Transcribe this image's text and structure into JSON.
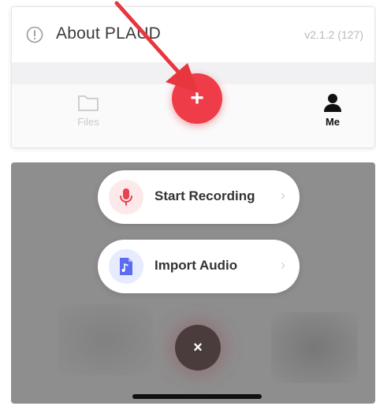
{
  "about": {
    "label": "About PLAUD",
    "version": "v2.1.2 (127)",
    "icon": "info-icon"
  },
  "tabbar": {
    "files_label": "Files",
    "me_label": "Me",
    "add_symbol": "+"
  },
  "menu": {
    "start_recording": "Start Recording",
    "import_audio": "Import Audio",
    "chevron": "›",
    "close_symbol": "×"
  },
  "colors": {
    "accent_red": "#ee3c49",
    "overlay_gray": "#8e8e8e",
    "close_dark": "#4a3c3d",
    "import_blue": "#5b6cf0"
  }
}
